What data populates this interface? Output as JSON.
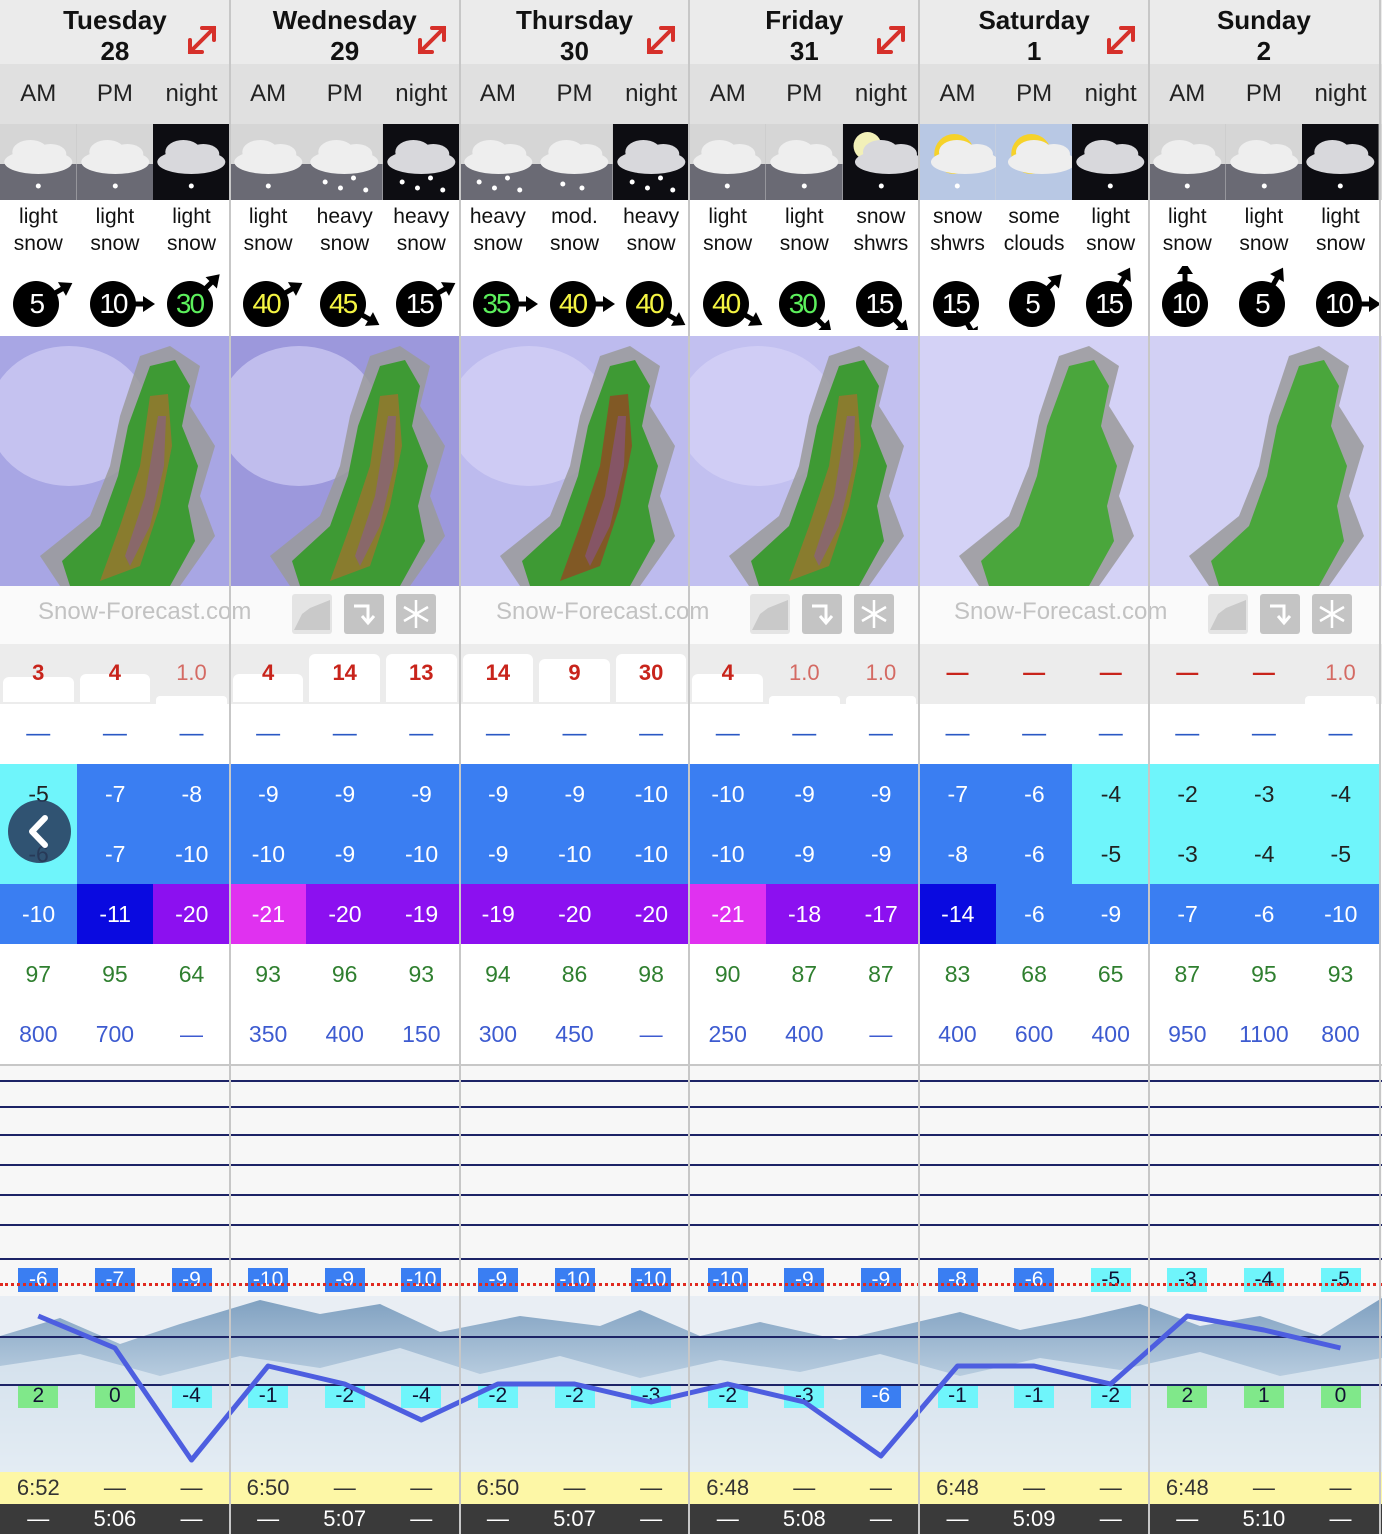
{
  "days": [
    {
      "name": "Tuesday",
      "date": "28",
      "sunrise": "6:52",
      "sunset": "5:06"
    },
    {
      "name": "Wednesday",
      "date": "29",
      "sunrise": "6:50",
      "sunset": "5:07"
    },
    {
      "name": "Thursday",
      "date": "30",
      "sunrise": "6:50",
      "sunset": "5:07"
    },
    {
      "name": "Friday",
      "date": "31",
      "sunrise": "6:48",
      "sunset": "5:08"
    },
    {
      "name": "Saturday",
      "date": "1",
      "sunrise": "6:48",
      "sunset": "5:09"
    },
    {
      "name": "Sunday",
      "date": "2",
      "sunrise": "6:48",
      "sunset": "5:10"
    }
  ],
  "period_labels": [
    "AM",
    "PM",
    "night"
  ],
  "branding": {
    "logo_text": "Snow-Forecast.com"
  },
  "placeholder": "—",
  "colors": {
    "temp_cyan": "#6ff5fb",
    "temp_blue": "#3a7ef2",
    "temp_darkblue": "#0a0ae0",
    "temp_purple": "#8c10f0",
    "temp_magenta": "#e031f0",
    "tag_green": "#80e88a",
    "arrow_red": "#d6302a",
    "freeze_line": "#e02a20",
    "summit_line": "#4d5ee0",
    "sunrise_bg": "#fdf7a6",
    "sunset_bg": "#3a3a3a"
  },
  "periods": [
    {
      "icon": "cloud-light-snow",
      "sky": "day",
      "desc": "light\nsnow",
      "wind": "5",
      "wind_color": "white",
      "wind_dir": 60,
      "snow": "3",
      "snow_light": false,
      "rain": "—",
      "t1": "-5",
      "c1": "cyan",
      "t2": "-6",
      "c2": "cyan",
      "t3": "-10",
      "c3": "blue",
      "humidity": "97",
      "freezing": "800",
      "fl_tag": "-6",
      "fl_tag_color": "blue",
      "summit": 2,
      "summit_color": "green"
    },
    {
      "icon": "cloud-light-snow",
      "sky": "day",
      "desc": "light\nsnow",
      "wind": "10",
      "wind_color": "white",
      "wind_dir": 90,
      "snow": "4",
      "snow_light": false,
      "rain": "—",
      "t1": "-7",
      "c1": "blue",
      "t2": "-7",
      "c2": "blue",
      "t3": "-11",
      "c3": "darkblue",
      "humidity": "95",
      "freezing": "700",
      "fl_tag": "-7",
      "fl_tag_color": "blue",
      "summit": 0,
      "summit_color": "green"
    },
    {
      "icon": "cloud-light-snow",
      "sky": "night",
      "desc": "light\nsnow",
      "wind": "30",
      "wind_color": "green",
      "wind_dir": 45,
      "snow": "1.0",
      "snow_light": true,
      "rain": "—",
      "t1": "-8",
      "c1": "blue",
      "t2": "-10",
      "c2": "blue",
      "t3": "-20",
      "c3": "purple",
      "humidity": "64",
      "freezing": "—",
      "fl_tag": "-9",
      "fl_tag_color": "blue",
      "summit": -4,
      "summit_color": "cyan"
    },
    {
      "icon": "cloud-light-snow",
      "sky": "day",
      "desc": "light\nsnow",
      "wind": "40",
      "wind_color": "yellow",
      "wind_dir": 60,
      "snow": "4",
      "snow_light": false,
      "rain": "—",
      "t1": "-9",
      "c1": "blue",
      "t2": "-10",
      "c2": "blue",
      "t3": "-21",
      "c3": "magenta",
      "humidity": "93",
      "freezing": "350",
      "fl_tag": "-10",
      "fl_tag_color": "blue",
      "summit": -1,
      "summit_color": "cyan"
    },
    {
      "icon": "cloud-heavy-snow",
      "sky": "day",
      "desc": "heavy\nsnow",
      "wind": "45",
      "wind_color": "yellow",
      "wind_dir": 120,
      "snow": "14",
      "snow_light": false,
      "rain": "—",
      "t1": "-9",
      "c1": "blue",
      "t2": "-9",
      "c2": "blue",
      "t3": "-20",
      "c3": "purple",
      "humidity": "96",
      "freezing": "400",
      "fl_tag": "-9",
      "fl_tag_color": "blue",
      "summit": -2,
      "summit_color": "cyan"
    },
    {
      "icon": "cloud-heavy-snow",
      "sky": "night",
      "desc": "heavy\nsnow",
      "wind": "15",
      "wind_color": "white",
      "wind_dir": 60,
      "snow": "13",
      "snow_light": false,
      "rain": "—",
      "t1": "-9",
      "c1": "blue",
      "t2": "-10",
      "c2": "blue",
      "t3": "-19",
      "c3": "purple",
      "humidity": "93",
      "freezing": "150",
      "fl_tag": "-10",
      "fl_tag_color": "blue",
      "summit": -4,
      "summit_color": "cyan"
    },
    {
      "icon": "cloud-heavy-snow",
      "sky": "day",
      "desc": "heavy\nsnow",
      "wind": "35",
      "wind_color": "green",
      "wind_dir": 90,
      "snow": "14",
      "snow_light": false,
      "rain": "—",
      "t1": "-9",
      "c1": "blue",
      "t2": "-9",
      "c2": "blue",
      "t3": "-19",
      "c3": "purple",
      "humidity": "94",
      "freezing": "300",
      "fl_tag": "-9",
      "fl_tag_color": "blue",
      "summit": -2,
      "summit_color": "cyan"
    },
    {
      "icon": "cloud-mod-snow",
      "sky": "day",
      "desc": "mod.\nsnow",
      "wind": "40",
      "wind_color": "yellow",
      "wind_dir": 90,
      "snow": "9",
      "snow_light": false,
      "rain": "—",
      "t1": "-9",
      "c1": "blue",
      "t2": "-10",
      "c2": "blue",
      "t3": "-20",
      "c3": "purple",
      "humidity": "86",
      "freezing": "450",
      "fl_tag": "-10",
      "fl_tag_color": "blue",
      "summit": -2,
      "summit_color": "cyan"
    },
    {
      "icon": "cloud-heavy-snow",
      "sky": "night",
      "desc": "heavy\nsnow",
      "wind": "40",
      "wind_color": "yellow",
      "wind_dir": 120,
      "snow": "30",
      "snow_light": false,
      "rain": "—",
      "t1": "-10",
      "c1": "blue",
      "t2": "-10",
      "c2": "blue",
      "t3": "-20",
      "c3": "purple",
      "humidity": "98",
      "freezing": "—",
      "fl_tag": "-10",
      "fl_tag_color": "blue",
      "summit": -3,
      "summit_color": "cyan"
    },
    {
      "icon": "cloud-light-snow",
      "sky": "day",
      "desc": "light\nsnow",
      "wind": "40",
      "wind_color": "yellow",
      "wind_dir": 120,
      "snow": "4",
      "snow_light": false,
      "rain": "—",
      "t1": "-10",
      "c1": "blue",
      "t2": "-10",
      "c2": "blue",
      "t3": "-21",
      "c3": "magenta",
      "humidity": "90",
      "freezing": "250",
      "fl_tag": "-10",
      "fl_tag_color": "blue",
      "summit": -2,
      "summit_color": "cyan"
    },
    {
      "icon": "cloud-light-snow",
      "sky": "day",
      "desc": "light\nsnow",
      "wind": "30",
      "wind_color": "green",
      "wind_dir": 135,
      "snow": "1.0",
      "snow_light": true,
      "rain": "—",
      "t1": "-9",
      "c1": "blue",
      "t2": "-9",
      "c2": "blue",
      "t3": "-18",
      "c3": "purple",
      "humidity": "87",
      "freezing": "400",
      "fl_tag": "-9",
      "fl_tag_color": "blue",
      "summit": -3,
      "summit_color": "cyan"
    },
    {
      "icon": "moon-cloud-snow",
      "sky": "night",
      "desc": "snow\nshwrs",
      "wind": "15",
      "wind_color": "white",
      "wind_dir": 135,
      "snow": "1.0",
      "snow_light": true,
      "rain": "—",
      "t1": "-9",
      "c1": "blue",
      "t2": "-9",
      "c2": "blue",
      "t3": "-17",
      "c3": "purple",
      "humidity": "87",
      "freezing": "—",
      "fl_tag": "-9",
      "fl_tag_color": "blue",
      "summit": -6,
      "summit_color": "blue"
    },
    {
      "icon": "sun-cloud-snow",
      "sky": "clear",
      "desc": "snow\nshwrs",
      "wind": "15",
      "wind_color": "white",
      "wind_dir": 150,
      "snow": "—",
      "snow_light": false,
      "rain": "—",
      "t1": "-7",
      "c1": "blue",
      "t2": "-8",
      "c2": "blue",
      "t3": "-14",
      "c3": "darkblue",
      "humidity": "83",
      "freezing": "400",
      "fl_tag": "-8",
      "fl_tag_color": "blue",
      "summit": -1,
      "summit_color": "cyan"
    },
    {
      "icon": "sun-cloud",
      "sky": "clear",
      "desc": "some\nclouds",
      "wind": "5",
      "wind_color": "white",
      "wind_dir": 45,
      "snow": "—",
      "snow_light": false,
      "rain": "—",
      "t1": "-6",
      "c1": "blue",
      "t2": "-6",
      "c2": "blue",
      "t3": "-6",
      "c3": "blue",
      "humidity": "68",
      "freezing": "600",
      "fl_tag": "-6",
      "fl_tag_color": "blue",
      "summit": -1,
      "summit_color": "cyan"
    },
    {
      "icon": "cloud-light-snow",
      "sky": "night",
      "desc": "light\nsnow",
      "wind": "15",
      "wind_color": "white",
      "wind_dir": 30,
      "snow": "—",
      "snow_light": false,
      "rain": "—",
      "t1": "-4",
      "c1": "cyan",
      "t2": "-5",
      "c2": "cyan",
      "t3": "-9",
      "c3": "blue",
      "humidity": "65",
      "freezing": "400",
      "fl_tag": "-5",
      "fl_tag_color": "cyan",
      "summit": -2,
      "summit_color": "cyan"
    },
    {
      "icon": "cloud-light-snow",
      "sky": "day",
      "desc": "light\nsnow",
      "wind": "10",
      "wind_color": "white",
      "wind_dir": 0,
      "snow": "—",
      "snow_light": false,
      "rain": "—",
      "t1": "-2",
      "c1": "cyan",
      "t2": "-3",
      "c2": "cyan",
      "t3": "-7",
      "c3": "blue",
      "humidity": "87",
      "freezing": "950",
      "fl_tag": "-3",
      "fl_tag_color": "cyan",
      "summit": 2,
      "summit_color": "green"
    },
    {
      "icon": "cloud-light-snow",
      "sky": "day",
      "desc": "light\nsnow",
      "wind": "5",
      "wind_color": "white",
      "wind_dir": 30,
      "snow": "—",
      "snow_light": false,
      "rain": "—",
      "t1": "-3",
      "c1": "cyan",
      "t2": "-4",
      "c2": "cyan",
      "t3": "-6",
      "c3": "blue",
      "humidity": "95",
      "freezing": "1100",
      "fl_tag": "-4",
      "fl_tag_color": "cyan",
      "summit": 1,
      "summit_color": "green"
    },
    {
      "icon": "cloud-light-snow",
      "sky": "night",
      "desc": "light\nsnow",
      "wind": "10",
      "wind_color": "white",
      "wind_dir": 90,
      "snow": "1.0",
      "snow_light": true,
      "rain": "—",
      "t1": "-4",
      "c1": "cyan",
      "t2": "-5",
      "c2": "cyan",
      "t3": "-10",
      "c3": "blue",
      "humidity": "93",
      "freezing": "800",
      "fl_tag": "-5",
      "fl_tag_color": "cyan",
      "summit": 0,
      "summit_color": "green"
    }
  ]
}
